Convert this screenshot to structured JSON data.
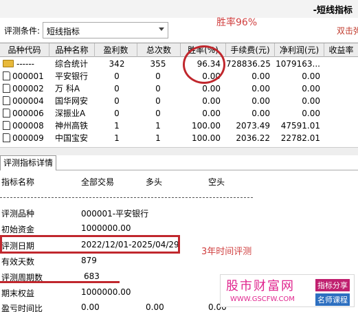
{
  "window": {
    "title": "-短线指标"
  },
  "criteria": {
    "label": "评测条件:",
    "selected": "短线指标"
  },
  "hint_double_click": "双击弹",
  "annotation_winrate": "胜率96%",
  "grid": {
    "headers": [
      "品种代码",
      "品种名称",
      "盈利数",
      "总次数",
      "胜率(%)",
      "手续费(元)",
      "净利润(元)",
      "收益率"
    ],
    "rows": [
      {
        "code": "------",
        "name": "综合统计",
        "profit": "342",
        "total": "355",
        "winrate": "96.34",
        "fee": "728836.25",
        "net": "1079163...",
        "icon": "folder-icon"
      },
      {
        "code": "000001",
        "name": "平安银行",
        "profit": "0",
        "total": "0",
        "winrate": "0.00",
        "fee": "0.00",
        "net": "0.00",
        "icon": "file-icon"
      },
      {
        "code": "000002",
        "name": "万 科A",
        "profit": "0",
        "total": "0",
        "winrate": "0.00",
        "fee": "0.00",
        "net": "0.00",
        "icon": "file-icon"
      },
      {
        "code": "000004",
        "name": "国华网安",
        "profit": "0",
        "total": "0",
        "winrate": "0.00",
        "fee": "0.00",
        "net": "0.00",
        "icon": "file-icon"
      },
      {
        "code": "000006",
        "name": "深振业A",
        "profit": "0",
        "total": "0",
        "winrate": "0.00",
        "fee": "0.00",
        "net": "0.00",
        "icon": "file-icon"
      },
      {
        "code": "000008",
        "name": "神州高铁",
        "profit": "1",
        "total": "1",
        "winrate": "100.00",
        "fee": "2073.49",
        "net": "47591.01",
        "icon": "file-icon"
      },
      {
        "code": "000009",
        "name": "中国宝安",
        "profit": "1",
        "total": "1",
        "winrate": "100.00",
        "fee": "2036.22",
        "net": "22782.01",
        "icon": "file-icon"
      }
    ]
  },
  "tab": {
    "label": "评测指标详情"
  },
  "detail": {
    "headers": [
      "指标名称",
      "全部交易",
      "多头",
      "空头"
    ],
    "rows": [
      {
        "label": "评测品种",
        "all": "000001-平安银行",
        "long": "",
        "short": ""
      },
      {
        "label": "初始资金",
        "all": "1000000.00",
        "long": "",
        "short": ""
      },
      {
        "label": "评测日期",
        "all": "2022/12/01-2025/04/29",
        "long": "",
        "short": ""
      },
      {
        "label": "有效天数",
        "all": "879",
        "long": "",
        "short": ""
      },
      {
        "label": "评测周期数",
        "all": "683",
        "long": "",
        "short": ""
      },
      {
        "label": "期末权益",
        "all": "1000000.00",
        "long": "",
        "short": ""
      },
      {
        "label": "盈亏时间比",
        "all": "0.00",
        "long": "0.00",
        "short": "0.00"
      }
    ]
  },
  "annotation_3yr": "3年时间评测",
  "watermark": {
    "title": "股市财富网",
    "url": "WWW.GSCFW.COM",
    "badge1": "指标分享",
    "badge2": "名师课程"
  },
  "colors": {
    "annotation_red": "#c0272d",
    "watermark_pink": "#e0248e",
    "folder_gold": "#e8b93a"
  }
}
